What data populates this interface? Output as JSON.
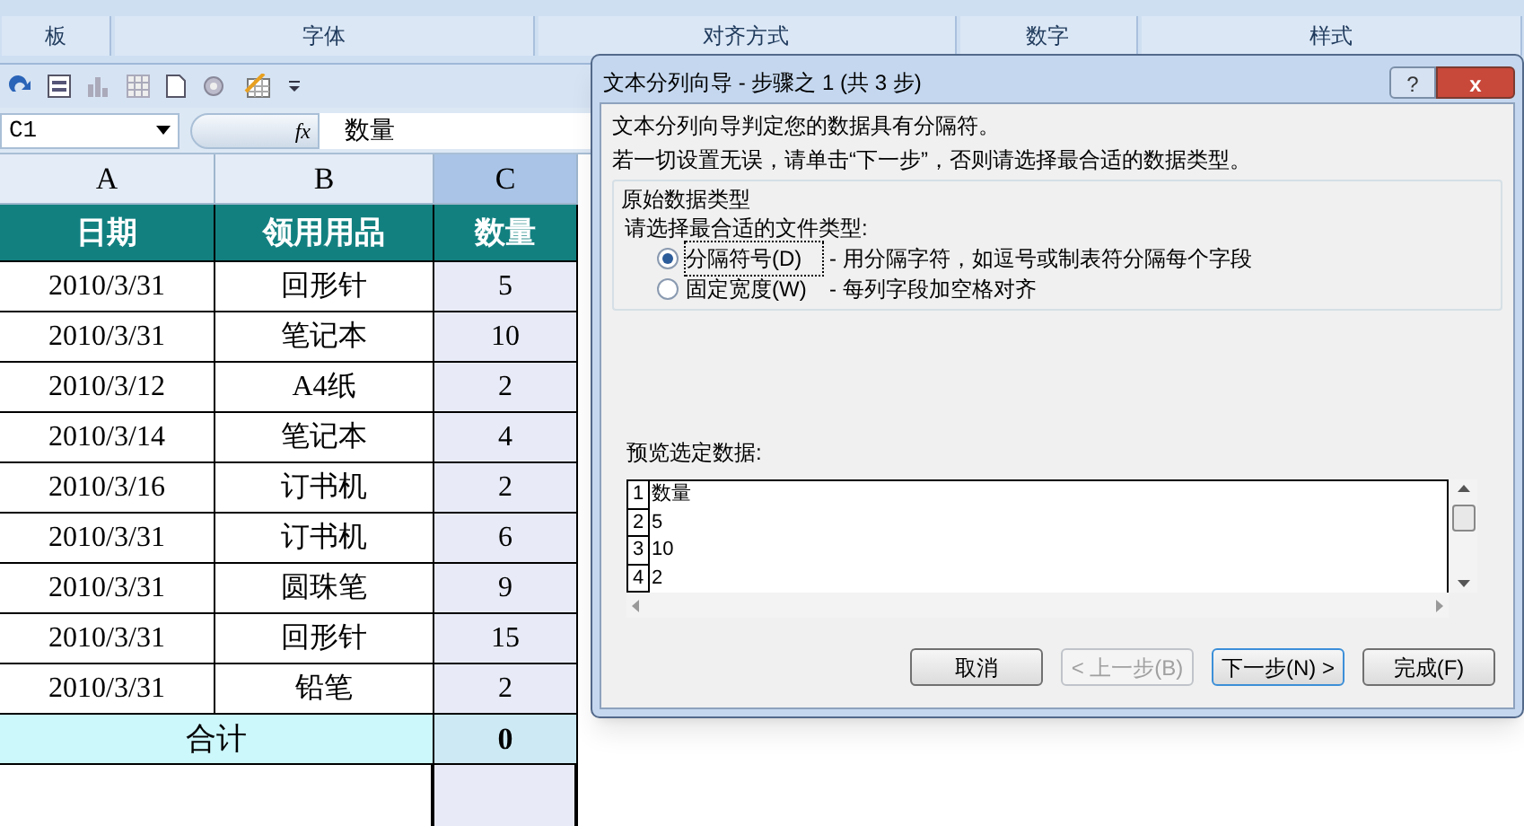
{
  "ribbon": {
    "groups": [
      {
        "label": "板"
      },
      {
        "label": "字体"
      },
      {
        "label": "对齐方式"
      },
      {
        "label": "数字"
      },
      {
        "label": "样式"
      }
    ]
  },
  "formula_bar": {
    "name_box": "C1",
    "fx": "fx",
    "value": "数量"
  },
  "sheet": {
    "columns": [
      {
        "label": "A",
        "selected": false
      },
      {
        "label": "B",
        "selected": false
      },
      {
        "label": "C",
        "selected": true
      }
    ],
    "header": [
      "日期",
      "领用用品",
      "数量"
    ],
    "rows": [
      [
        "2010/3/31",
        "回形针",
        "5"
      ],
      [
        "2010/3/31",
        "笔记本",
        "10"
      ],
      [
        "2010/3/12",
        "A4纸",
        "2"
      ],
      [
        "2010/3/14",
        "笔记本",
        "4"
      ],
      [
        "2010/3/16",
        "订书机",
        "2"
      ],
      [
        "2010/3/31",
        "订书机",
        "6"
      ],
      [
        "2010/3/31",
        "圆珠笔",
        "9"
      ],
      [
        "2010/3/31",
        "回形针",
        "15"
      ],
      [
        "2010/3/31",
        "铅笔",
        "2"
      ]
    ],
    "total": {
      "label": "合计",
      "value": "0"
    }
  },
  "dialog": {
    "title": "文本分列向导 - 步骤之 1 (共 3 步)",
    "help": "?",
    "close": "x",
    "intro": [
      "文本分列向导判定您的数据具有分隔符。",
      "若一切设置无误，请单击“下一步”，否则请选择最合适的数据类型。"
    ],
    "group_title": "原始数据类型",
    "prompt": "请选择最合适的文件类型:",
    "options": [
      {
        "label": "分隔符号(D)",
        "desc": "- 用分隔字符，如逗号或制表符分隔每个字段",
        "selected": true
      },
      {
        "label": "固定宽度(W)",
        "desc": "- 每列字段加空格对齐",
        "selected": false
      }
    ],
    "preview_label": "预览选定数据:",
    "preview": [
      {
        "num": "1",
        "text": "数量"
      },
      {
        "num": "2",
        "text": "5"
      },
      {
        "num": "3",
        "text": "10"
      },
      {
        "num": "4",
        "text": "2"
      }
    ],
    "buttons": [
      {
        "label": "取消",
        "disabled": false,
        "focused": false
      },
      {
        "label": "< 上一步(B)",
        "disabled": true,
        "focused": false
      },
      {
        "label": "下一步(N) >",
        "disabled": false,
        "focused": true
      },
      {
        "label": "完成(F)",
        "disabled": false,
        "focused": false
      }
    ]
  }
}
